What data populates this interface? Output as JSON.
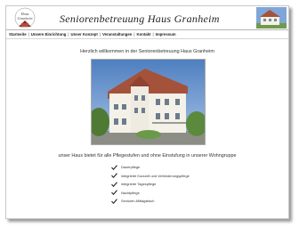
{
  "logo": {
    "name": "Haus-Granheim-logo",
    "text": "Haus Granheim"
  },
  "header": {
    "title": "Seniorenbetreuung Haus Granheim"
  },
  "nav": {
    "items": [
      {
        "label": "Startseite"
      },
      {
        "label": "Unsere Einrichtung"
      },
      {
        "label": "Unser Konzept"
      },
      {
        "label": "Veranstaltungen"
      },
      {
        "label": "Kontakt"
      },
      {
        "label": "Impressum"
      }
    ],
    "separator": "|"
  },
  "main": {
    "welcome": "Herzlich willkommen in der Seniorenbetreuung Haus Granheim",
    "tagline": "unser Haus bietet für alle Pflegestufen und ohne Einstufung in unserer Wohngruppe",
    "features": [
      "Dauerpflege",
      "integrierte Kurzzeit und Verhinderungspflege",
      "integrierte Tagespflege",
      "Nachtpflege",
      "Senioren-Mittagstisch"
    ],
    "check_icon": "checkmark-icon"
  },
  "colors": {
    "background": "#ffffff",
    "frame_border": "#c8c8c8",
    "text": "#333333",
    "sky": "#6a93c8",
    "house_wall": "#f4f1e8",
    "roof": "#a5523a"
  }
}
